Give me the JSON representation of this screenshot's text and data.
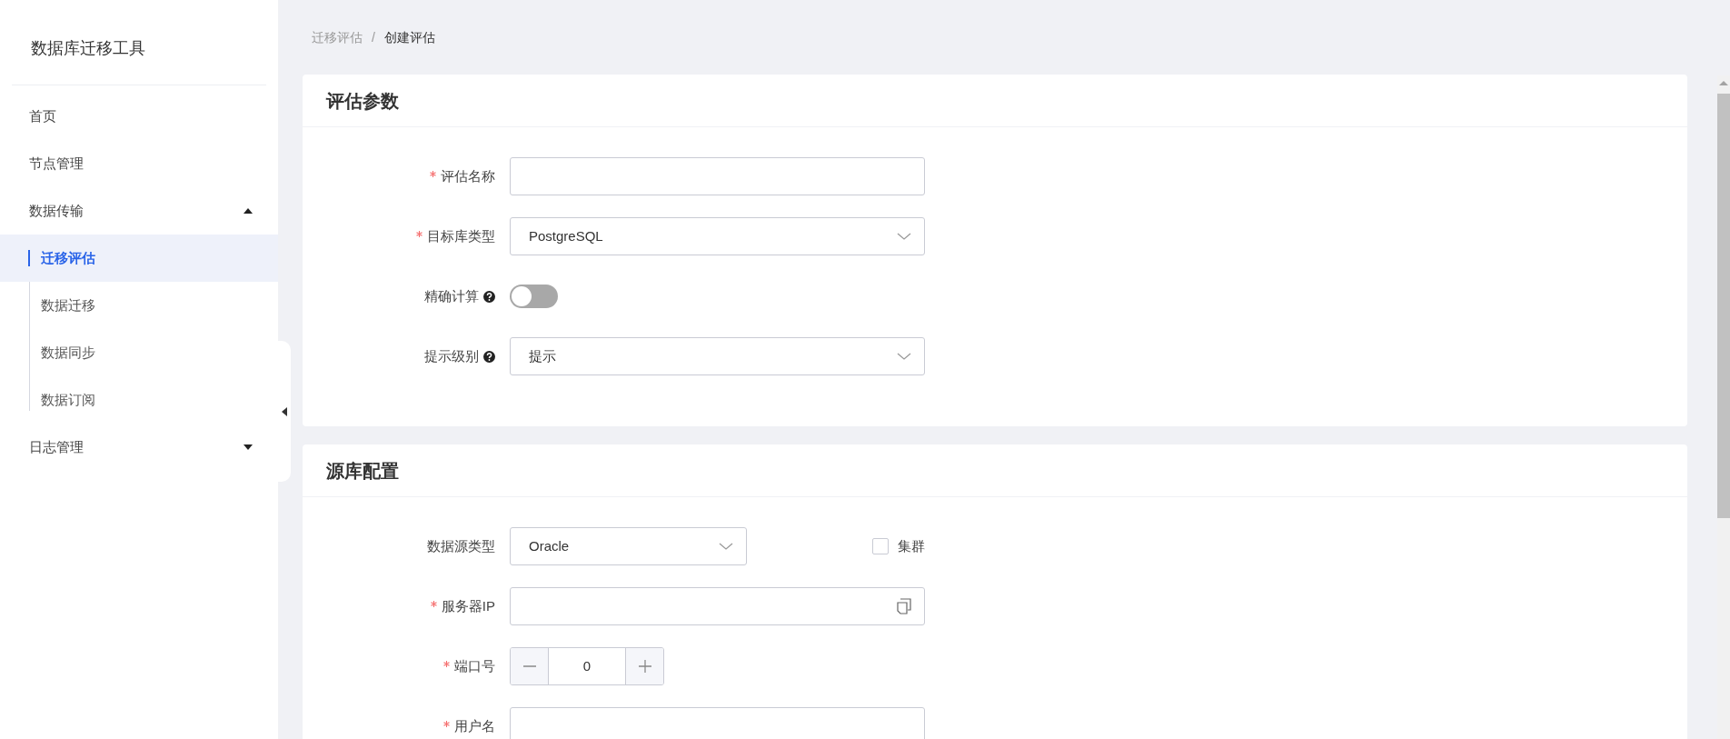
{
  "sidebar": {
    "title": "数据库迁移工具",
    "items": [
      {
        "label": "首页",
        "kind": "link"
      },
      {
        "label": "节点管理",
        "kind": "link"
      },
      {
        "label": "数据传输",
        "kind": "group",
        "expanded": true,
        "children": [
          {
            "label": "迁移评估",
            "selected": true
          },
          {
            "label": "数据迁移",
            "selected": false
          },
          {
            "label": "数据同步",
            "selected": false
          },
          {
            "label": "数据订阅",
            "selected": false
          }
        ]
      },
      {
        "label": "日志管理",
        "kind": "group",
        "expanded": false
      }
    ]
  },
  "breadcrumb": {
    "items": [
      "迁移评估",
      "创建评估"
    ],
    "separator": "/"
  },
  "sections": [
    {
      "title": "评估参数",
      "fields": [
        {
          "label": "评估名称",
          "required": true,
          "help": false,
          "kind": "text"
        },
        {
          "label": "目标库类型",
          "required": true,
          "help": false,
          "kind": "select",
          "value": "PostgreSQL"
        },
        {
          "label": "精确计算",
          "required": false,
          "help": true,
          "kind": "switch",
          "on": false
        },
        {
          "label": "提示级别",
          "required": false,
          "help": true,
          "kind": "select",
          "value": "提示"
        }
      ]
    },
    {
      "title": "源库配置",
      "fields": [
        {
          "label": "数据源类型",
          "required": false,
          "help": false,
          "kind": "select",
          "value": "Oracle",
          "checkbox": {
            "label": "集群",
            "checked": false
          }
        },
        {
          "label": "服务器IP",
          "required": true,
          "help": false,
          "kind": "ip"
        },
        {
          "label": "端口号",
          "required": true,
          "help": false,
          "kind": "number",
          "value": "0"
        },
        {
          "label": "用户名",
          "required": true,
          "help": false,
          "kind": "text"
        }
      ]
    }
  ]
}
